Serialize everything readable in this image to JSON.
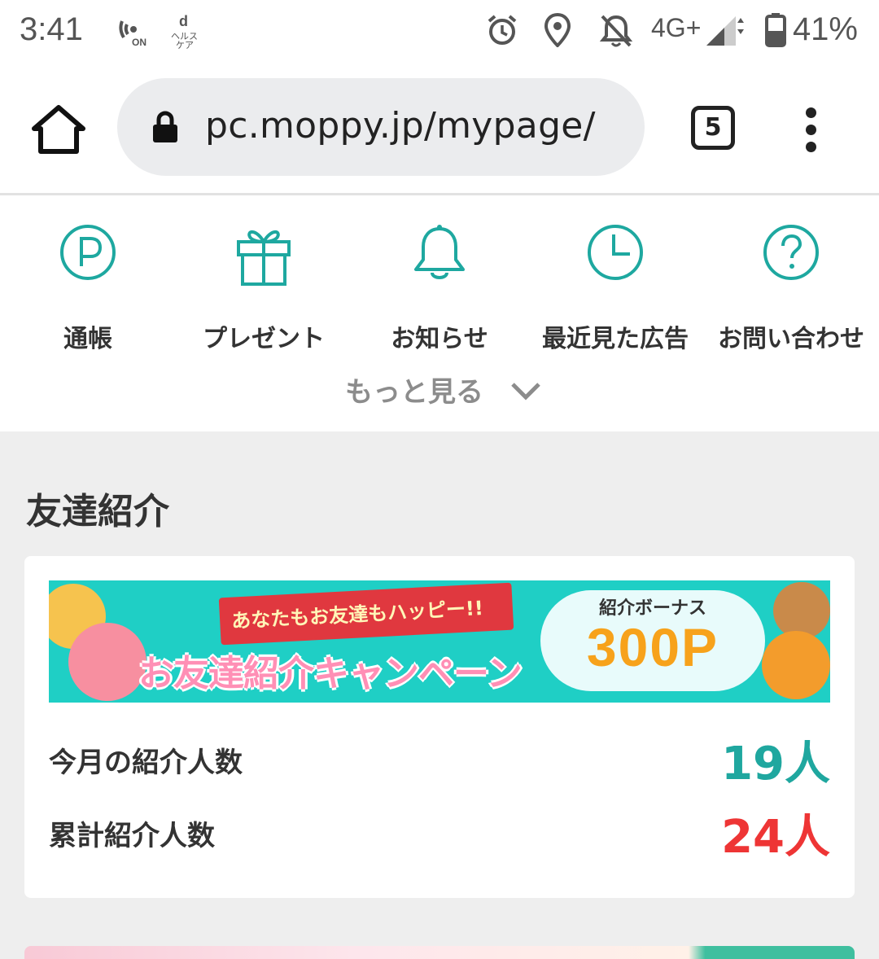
{
  "status_bar": {
    "time": "3:41",
    "network": "4G+",
    "battery": "41%",
    "icons": [
      "nfc-icon",
      "dhealth-icon",
      "alarm-icon",
      "location-icon",
      "notifications-off-icon",
      "signal-icon",
      "battery-icon"
    ]
  },
  "browser": {
    "url": "pc.moppy.jp/mypage/",
    "tab_count": "5"
  },
  "quick_menu": {
    "items": [
      {
        "label": "通帳",
        "icon": "points-icon"
      },
      {
        "label": "プレゼント",
        "icon": "gift-icon"
      },
      {
        "label": "お知らせ",
        "icon": "bell-icon"
      },
      {
        "label": "最近見た広告",
        "icon": "clock-icon"
      },
      {
        "label": "お問い合わせ",
        "icon": "help-icon"
      }
    ],
    "more_label": "もっと見る"
  },
  "friend_referral": {
    "title": "友達紹介",
    "banner": {
      "ribbon": "あなたもお友達もハッピー!!",
      "campaign": "お友達紹介キャンペーン",
      "bonus_label": "紹介ボーナス",
      "bonus_value": "300P"
    },
    "this_month_label": "今月の紹介人数",
    "this_month_value": "19人",
    "total_label": "累計紹介人数",
    "total_value": "24人"
  },
  "colors": {
    "accent": "#1ea8a0",
    "this_month_value": "#1fa79f",
    "total_value": "#ee3535",
    "section_bg": "#eeeeee"
  }
}
